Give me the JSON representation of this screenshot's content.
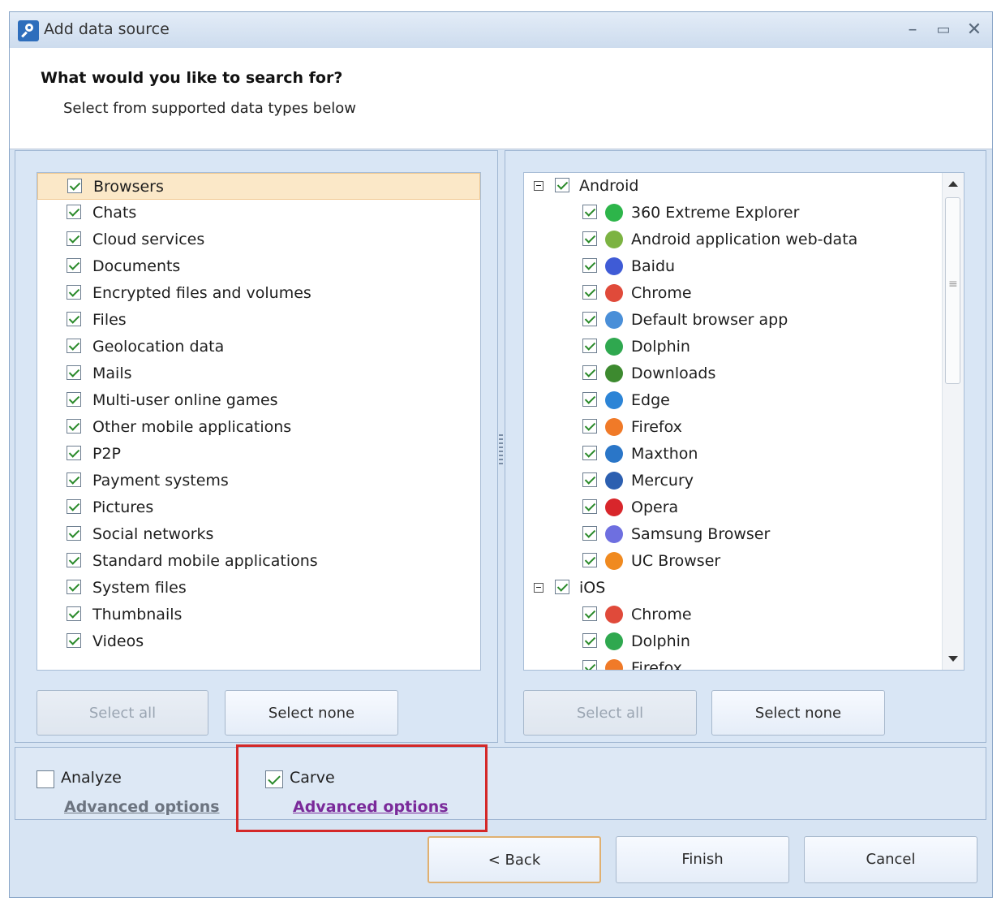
{
  "window": {
    "title": "Add data source"
  },
  "header": {
    "title": "What would you like to search for?",
    "subtitle": "Select from supported data types below"
  },
  "left_list": {
    "items": [
      {
        "label": "Browsers",
        "checked": true,
        "selected": true
      },
      {
        "label": "Chats",
        "checked": true
      },
      {
        "label": "Cloud services",
        "checked": true
      },
      {
        "label": "Documents",
        "checked": true
      },
      {
        "label": "Encrypted files and volumes",
        "checked": true
      },
      {
        "label": "Files",
        "checked": true
      },
      {
        "label": "Geolocation data",
        "checked": true
      },
      {
        "label": "Mails",
        "checked": true
      },
      {
        "label": "Multi-user online games",
        "checked": true
      },
      {
        "label": "Other mobile applications",
        "checked": true
      },
      {
        "label": "P2P",
        "checked": true
      },
      {
        "label": "Payment systems",
        "checked": true
      },
      {
        "label": "Pictures",
        "checked": true
      },
      {
        "label": "Social networks",
        "checked": true
      },
      {
        "label": "Standard mobile applications",
        "checked": true
      },
      {
        "label": "System files",
        "checked": true
      },
      {
        "label": "Thumbnails",
        "checked": true
      },
      {
        "label": "Videos",
        "checked": true
      }
    ],
    "select_all": "Select all",
    "select_none": "Select none"
  },
  "right_tree": {
    "groups": [
      {
        "label": "Android",
        "checked": true,
        "expanded": true,
        "children": [
          {
            "label": "360 Extreme Explorer",
            "icon": "360-extreme-explorer-icon",
            "color": "#2db54a"
          },
          {
            "label": "Android application web-data",
            "icon": "android-icon",
            "color": "#7cb342"
          },
          {
            "label": "Baidu",
            "icon": "baidu-icon",
            "color": "#3f5bd6"
          },
          {
            "label": "Chrome",
            "icon": "chrome-icon",
            "color": "#e04a3a"
          },
          {
            "label": "Default browser app",
            "icon": "globe-icon",
            "color": "#4a8fd8"
          },
          {
            "label": "Dolphin",
            "icon": "dolphin-icon",
            "color": "#2fa84f"
          },
          {
            "label": "Downloads",
            "icon": "download-arrow-icon",
            "color": "#3d8a2f"
          },
          {
            "label": "Edge",
            "icon": "edge-icon",
            "color": "#2c84d6"
          },
          {
            "label": "Firefox",
            "icon": "firefox-icon",
            "color": "#f07a28"
          },
          {
            "label": "Maxthon",
            "icon": "maxthon-icon",
            "color": "#2a76c8"
          },
          {
            "label": "Mercury",
            "icon": "mercury-icon",
            "color": "#2c5fb0"
          },
          {
            "label": "Opera",
            "icon": "opera-icon",
            "color": "#d8262b"
          },
          {
            "label": "Samsung Browser",
            "icon": "samsung-browser-icon",
            "color": "#6e6fe0"
          },
          {
            "label": "UC Browser",
            "icon": "uc-browser-icon",
            "color": "#f08a20"
          }
        ]
      },
      {
        "label": "iOS",
        "checked": true,
        "expanded": true,
        "children": [
          {
            "label": "Chrome",
            "icon": "chrome-icon",
            "color": "#e04a3a"
          },
          {
            "label": "Dolphin",
            "icon": "dolphin-icon",
            "color": "#2fa84f"
          },
          {
            "label": "Firefox",
            "icon": "firefox-icon",
            "color": "#f07a28"
          }
        ]
      }
    ],
    "select_all": "Select all",
    "select_none": "Select none"
  },
  "options": {
    "analyze": {
      "label": "Analyze",
      "checked": false,
      "advanced": "Advanced options",
      "link_color": "#6c7480"
    },
    "carve": {
      "label": "Carve",
      "checked": true,
      "advanced": "Advanced options",
      "link_color": "#7a2a9a"
    }
  },
  "footer": {
    "back": "< Back",
    "finish": "Finish",
    "cancel": "Cancel"
  }
}
